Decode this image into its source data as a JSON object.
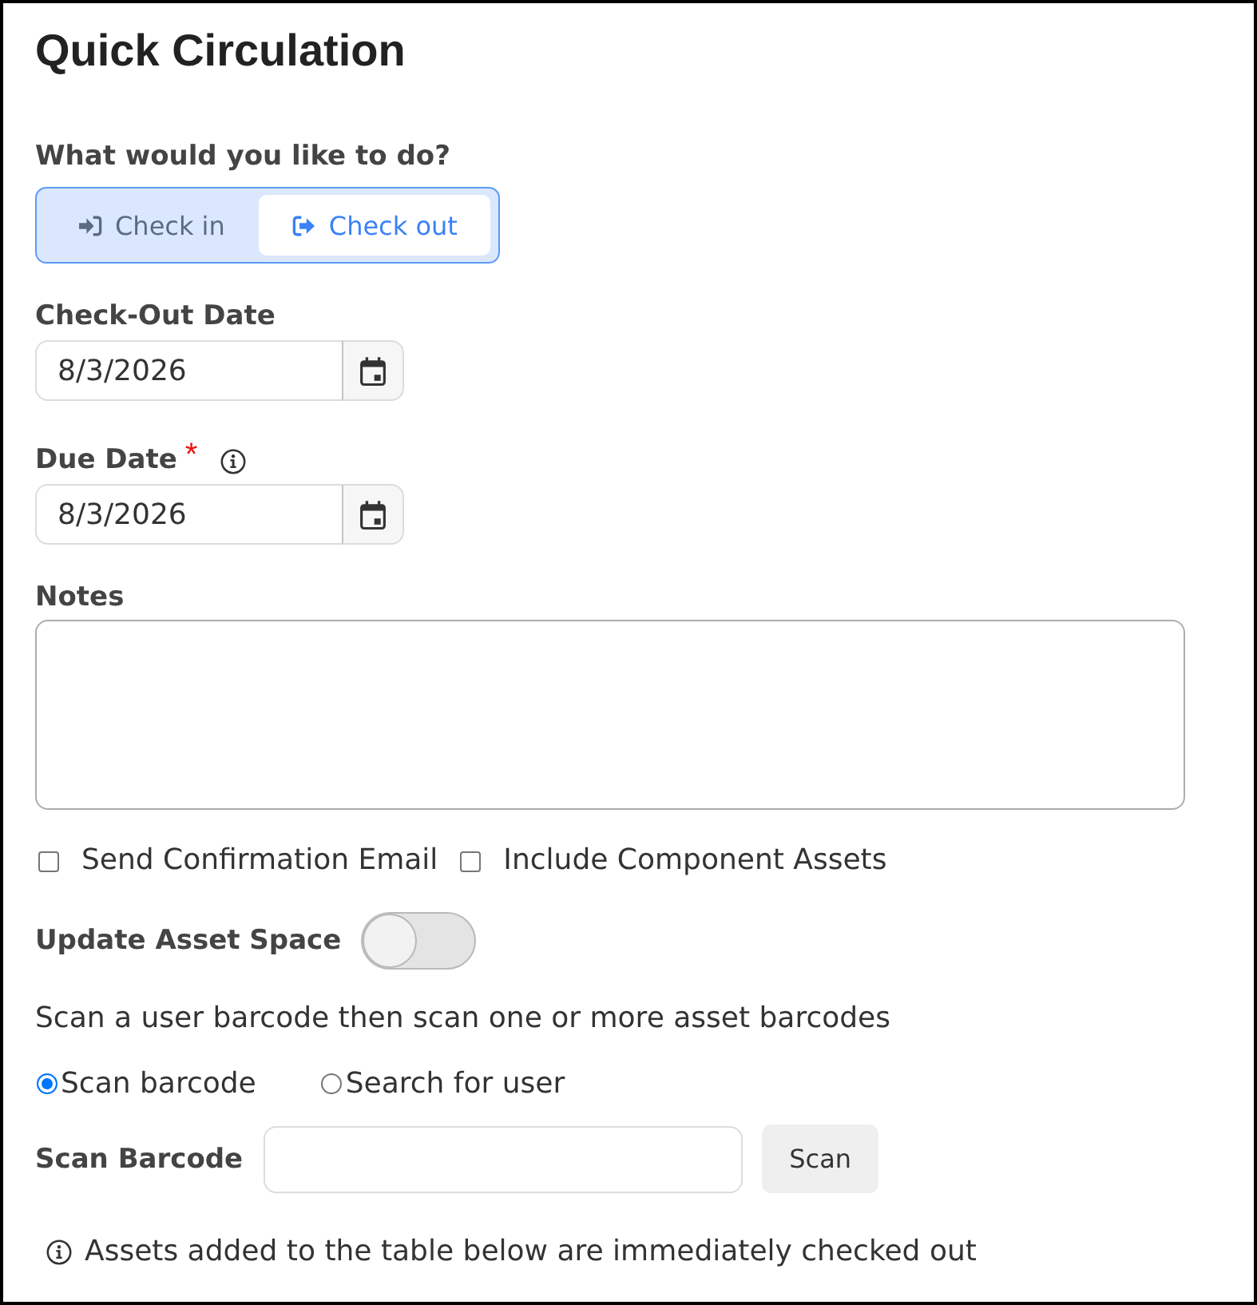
{
  "page": {
    "title": "Quick Circulation"
  },
  "action": {
    "label": "What would you like to do?",
    "options": [
      {
        "kind": "in",
        "label": "Check in",
        "selected": false
      },
      {
        "kind": "out",
        "label": "Check out",
        "selected": true
      }
    ]
  },
  "checkout_date": {
    "label": "Check-Out Date",
    "value": "8/3/2026"
  },
  "due_date": {
    "label": "Due Date",
    "required_mark": "*",
    "value": "8/3/2026"
  },
  "notes": {
    "label": "Notes"
  },
  "checkboxes": [
    {
      "label": "Send Confirmation Email",
      "checked": false
    },
    {
      "label": "Include Component Assets",
      "checked": false
    }
  ],
  "update_asset_space": {
    "label": "Update Asset Space",
    "on": false
  },
  "instructions": "Scan a user barcode then scan one or more asset barcodes",
  "scan_mode": [
    {
      "label": "Scan barcode",
      "selected": true
    },
    {
      "label": "Search for user",
      "selected": false
    }
  ],
  "scan_barcode": {
    "label": "Scan Barcode",
    "button": "Scan"
  },
  "notice": "Assets added to the table below are immediately checked out"
}
